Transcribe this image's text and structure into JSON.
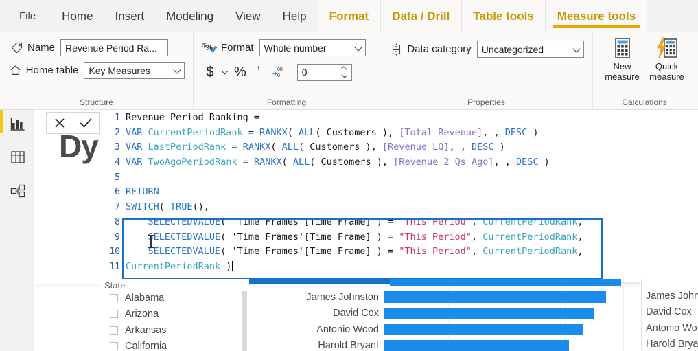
{
  "ribbon": {
    "tabs": [
      {
        "label": "File",
        "type": "file",
        "active": false
      },
      {
        "label": "Home",
        "type": "normal",
        "active": false
      },
      {
        "label": "Insert",
        "type": "normal",
        "active": false
      },
      {
        "label": "Modeling",
        "type": "normal",
        "active": false
      },
      {
        "label": "View",
        "type": "normal",
        "active": false
      },
      {
        "label": "Help",
        "type": "normal",
        "active": false
      },
      {
        "label": "Format",
        "type": "contextual",
        "active": false
      },
      {
        "label": "Data / Drill",
        "type": "contextual",
        "active": false
      },
      {
        "label": "Table tools",
        "type": "contextual",
        "active": false
      },
      {
        "label": "Measure tools",
        "type": "contextual",
        "active": true
      }
    ],
    "groups": {
      "structure": {
        "label": "Structure",
        "name_label": "Name",
        "name_value": "Revenue Period Ra...",
        "home_table_label": "Home table",
        "home_table_value": "Key Measures"
      },
      "formatting": {
        "label": "Formatting",
        "format_label": "Format",
        "format_value": "Whole number",
        "currency_glyph": "$",
        "percent_glyph": "%",
        "thousands_glyph": "‰",
        "decimal_value": "0"
      },
      "properties": {
        "label": "Properties",
        "data_category_label": "Data category",
        "data_category_value": "Uncategorized"
      },
      "calculations": {
        "label": "Calculations",
        "new_measure_line1": "New",
        "new_measure_line2": "measure",
        "quick_measure_line1": "Quick",
        "quick_measure_line2": "measure"
      }
    }
  },
  "left_rail": {
    "items": [
      {
        "name": "report-view",
        "label": "Report"
      },
      {
        "name": "data-view",
        "label": "Data"
      },
      {
        "name": "model-view",
        "label": "Model"
      }
    ]
  },
  "canvas": {
    "report_title_partial": "Dy"
  },
  "formula_bar": {
    "cancel_glyph": "✕",
    "accept_glyph": "✓"
  },
  "dax_editor": {
    "accent_color": "#1572c8",
    "lines": [
      {
        "num": "1",
        "tokens": [
          {
            "t": "Revenue Period Ranking =",
            "c": "t-plain"
          }
        ]
      },
      {
        "num": "2",
        "tokens": [
          {
            "t": "VAR ",
            "c": "t-kw"
          },
          {
            "t": "CurrentPeriodRank",
            "c": "t-var"
          },
          {
            "t": " = ",
            "c": "t-punc"
          },
          {
            "t": "RANKX",
            "c": "t-fn"
          },
          {
            "t": "( ",
            "c": "t-punc"
          },
          {
            "t": "ALL",
            "c": "t-fn"
          },
          {
            "t": "( Customers ), ",
            "c": "t-punc"
          },
          {
            "t": "[Total Revenue]",
            "c": "t-meas"
          },
          {
            "t": ", , ",
            "c": "t-punc"
          },
          {
            "t": "DESC",
            "c": "t-fn"
          },
          {
            "t": " )",
            "c": "t-punc"
          }
        ]
      },
      {
        "num": "3",
        "tokens": [
          {
            "t": "VAR ",
            "c": "t-kw"
          },
          {
            "t": "LastPeriodRank",
            "c": "t-var"
          },
          {
            "t": " = ",
            "c": "t-punc"
          },
          {
            "t": "RANKX",
            "c": "t-fn"
          },
          {
            "t": "( ",
            "c": "t-punc"
          },
          {
            "t": "ALL",
            "c": "t-fn"
          },
          {
            "t": "( Customers ), ",
            "c": "t-punc"
          },
          {
            "t": "[Revenue LQ]",
            "c": "t-meas"
          },
          {
            "t": ", , ",
            "c": "t-punc"
          },
          {
            "t": "DESC",
            "c": "t-fn"
          },
          {
            "t": " )",
            "c": "t-punc"
          }
        ]
      },
      {
        "num": "4",
        "tokens": [
          {
            "t": "VAR ",
            "c": "t-kw"
          },
          {
            "t": "TwoAgoPeriodRank",
            "c": "t-var"
          },
          {
            "t": " = ",
            "c": "t-punc"
          },
          {
            "t": "RANKX",
            "c": "t-fn"
          },
          {
            "t": "( ",
            "c": "t-punc"
          },
          {
            "t": "ALL",
            "c": "t-fn"
          },
          {
            "t": "( Customers ), ",
            "c": "t-punc"
          },
          {
            "t": "[Revenue 2 Qs Ago]",
            "c": "t-meas"
          },
          {
            "t": ", , ",
            "c": "t-punc"
          },
          {
            "t": "DESC",
            "c": "t-fn"
          },
          {
            "t": " )",
            "c": "t-punc"
          }
        ]
      },
      {
        "num": "5",
        "tokens": [
          {
            "t": "",
            "c": "t-plain"
          }
        ]
      },
      {
        "num": "6",
        "tokens": [
          {
            "t": "RETURN",
            "c": "t-kw"
          }
        ]
      },
      {
        "num": "7",
        "tokens": [
          {
            "t": "SWITCH",
            "c": "t-fn"
          },
          {
            "t": "( ",
            "c": "t-punc"
          },
          {
            "t": "TRUE",
            "c": "t-fn"
          },
          {
            "t": "(),",
            "c": "t-punc"
          }
        ]
      },
      {
        "num": "8",
        "tokens": [
          {
            "t": "    ",
            "c": "t-punc"
          },
          {
            "t": "SELECTEDVALUE",
            "c": "t-fn"
          },
          {
            "t": "( 'Time Frames'[Time Frame] ) = ",
            "c": "t-punc"
          },
          {
            "t": "\"This Period\"",
            "c": "t-str"
          },
          {
            "t": ", ",
            "c": "t-punc"
          },
          {
            "t": "CurrentPeriodRank",
            "c": "t-var"
          },
          {
            "t": ",",
            "c": "t-punc"
          }
        ]
      },
      {
        "num": "9",
        "tokens": [
          {
            "t": "    ",
            "c": "t-punc"
          },
          {
            "t": "SELECTEDVALUE",
            "c": "t-fn"
          },
          {
            "t": "( 'Time Frames'[Time Frame] ) = ",
            "c": "t-punc"
          },
          {
            "t": "\"This Period\"",
            "c": "t-str"
          },
          {
            "t": ", ",
            "c": "t-punc"
          },
          {
            "t": "CurrentPeriodRank",
            "c": "t-var"
          },
          {
            "t": ",",
            "c": "t-punc"
          }
        ]
      },
      {
        "num": "10",
        "tokens": [
          {
            "t": "    ",
            "c": "t-punc"
          },
          {
            "t": "SELECTEDVALUE",
            "c": "t-fn"
          },
          {
            "t": "( 'Time Frames'[Time Frame] ) = ",
            "c": "t-punc"
          },
          {
            "t": "\"This Period\"",
            "c": "t-str"
          },
          {
            "t": ", ",
            "c": "t-punc"
          },
          {
            "t": "CurrentPeriodRank",
            "c": "t-var"
          },
          {
            "t": ",",
            "c": "t-punc"
          }
        ]
      },
      {
        "num": "11",
        "tokens": [
          {
            "t": "CurrentPeriodRank",
            "c": "t-var"
          },
          {
            "t": " )",
            "c": "t-punc"
          }
        ]
      }
    ]
  },
  "visuals": {
    "slicer": {
      "title": "State",
      "items": [
        {
          "label": "Alabama",
          "checked": false
        },
        {
          "label": "Arizona",
          "checked": false
        },
        {
          "label": "Arkansas",
          "checked": false
        },
        {
          "label": "California",
          "checked": false
        }
      ]
    },
    "bar_chart": {
      "bar_color": "#1b8bec",
      "rows": [
        {
          "label": "James Johnston",
          "value": 95
        },
        {
          "label": "David Cox",
          "value": 90
        },
        {
          "label": "Antonio Wood",
          "value": 85
        },
        {
          "label": "Harold Bryant",
          "value": 79
        }
      ]
    },
    "side_table": {
      "rows": [
        {
          "label": "James Johns"
        },
        {
          "label": "David Cox"
        },
        {
          "label": "Antonio Wo"
        },
        {
          "label": "Harold Brya"
        }
      ]
    }
  },
  "chart_data": {
    "type": "bar",
    "title": "",
    "orientation": "horizontal",
    "categories": [
      "James Johnston",
      "David Cox",
      "Antonio Wood",
      "Harold Bryant"
    ],
    "values": [
      95,
      90,
      85,
      79
    ],
    "xlabel": "",
    "ylabel": "",
    "xlim": [
      0,
      100
    ],
    "grid": true,
    "legend": "none",
    "series": [
      {
        "name": "Total Revenue",
        "values": [
          95,
          90,
          85,
          79
        ]
      }
    ]
  }
}
